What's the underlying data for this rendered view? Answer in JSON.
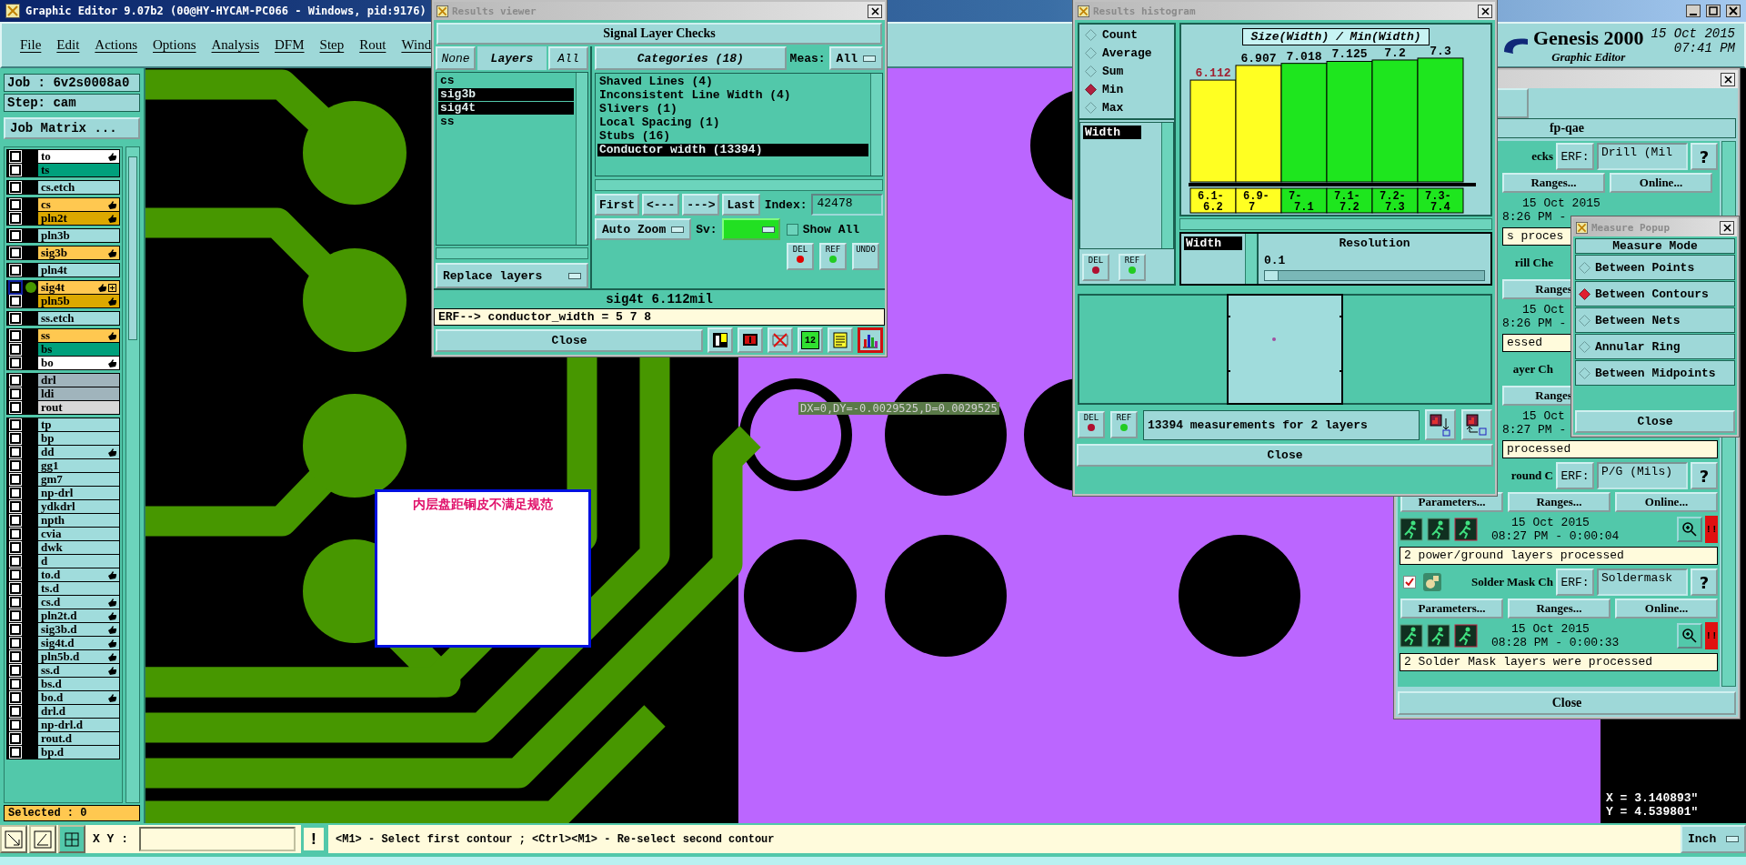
{
  "window": {
    "title": "Graphic Editor 9.07b2 (00@HY-HYCAM-PC066 - Windows, pid:9176)"
  },
  "menu": [
    "File",
    "Edit",
    "Actions",
    "Options",
    "Analysis",
    "DFM",
    "Step",
    "Rout",
    "Wind"
  ],
  "brand": {
    "name": "Genesis 2000",
    "subtitle": "Graphic Editor",
    "date": "15 Oct 2015",
    "time": "07:41 PM"
  },
  "job": {
    "job": "Job : 6v2s0008a0",
    "step": "Step: cam",
    "matrix_button": "Job Matrix ..."
  },
  "layer_groups": [
    {
      "layers": [
        {
          "name": "to",
          "color": "#ffffff",
          "affected": true,
          "work": false,
          "checked": false
        },
        {
          "name": "ts",
          "color": "#00a07c",
          "affected": false,
          "work": false,
          "checked": false
        }
      ]
    },
    {
      "layers": [
        {
          "name": "cs.etch",
          "color": "#a0dcdc",
          "affected": false,
          "work": false,
          "checked": false
        }
      ]
    },
    {
      "layers": [
        {
          "name": "cs",
          "color": "#ffc850",
          "affected": true,
          "work": false,
          "checked": false
        },
        {
          "name": "pln2t",
          "color": "#dca800",
          "affected": true,
          "work": false,
          "checked": false
        }
      ]
    },
    {
      "layers": [
        {
          "name": "pln3b",
          "color": "#a0dcdc",
          "affected": false,
          "work": false,
          "checked": false
        }
      ]
    },
    {
      "layers": [
        {
          "name": "sig3b",
          "color": "#ffc850",
          "affected": true,
          "work": false,
          "checked": false
        }
      ]
    },
    {
      "layers": [
        {
          "name": "pln4t",
          "color": "#a0dcdc",
          "affected": false,
          "work": false,
          "checked": false
        }
      ]
    },
    {
      "layers": [
        {
          "name": "sig4t",
          "color": "#ffc850",
          "affected": true,
          "work": true,
          "checked": false
        },
        {
          "name": "pln5b",
          "color": "#dca800",
          "affected": true,
          "work": false,
          "checked": false
        }
      ]
    },
    {
      "layers": [
        {
          "name": "ss.etch",
          "color": "#a0dcdc",
          "affected": false,
          "work": false,
          "checked": false
        }
      ]
    },
    {
      "layers": [
        {
          "name": "ss",
          "color": "#ffc850",
          "affected": true,
          "work": false,
          "checked": false
        },
        {
          "name": "bs",
          "color": "#00a07c",
          "affected": false,
          "work": false,
          "checked": false
        },
        {
          "name": "bo",
          "color": "#ffffff",
          "affected": true,
          "work": false,
          "checked": false
        }
      ]
    },
    {
      "layers": [
        {
          "name": "drl",
          "color": "#a0b4bc",
          "affected": false,
          "work": false,
          "checked": false
        },
        {
          "name": "ldi",
          "color": "#a0b4bc",
          "affected": false,
          "work": false,
          "checked": false
        },
        {
          "name": "rout",
          "color": "#d8d8d8",
          "affected": false,
          "work": false,
          "checked": false
        }
      ]
    },
    {
      "layers": [
        {
          "name": "tp",
          "color": "#a0dcdc",
          "affected": false,
          "work": false,
          "checked": false
        },
        {
          "name": "bp",
          "color": "#a0dcdc",
          "affected": false,
          "work": false,
          "checked": false
        },
        {
          "name": "dd",
          "color": "#a0dcdc",
          "affected": true,
          "work": false,
          "checked": false
        },
        {
          "name": "gg1",
          "color": "#a0dcdc",
          "affected": false,
          "work": false,
          "checked": false
        },
        {
          "name": "gm7",
          "color": "#a0dcdc",
          "affected": false,
          "work": false,
          "checked": false
        },
        {
          "name": "np-drl",
          "color": "#a0dcdc",
          "affected": false,
          "work": false,
          "checked": false
        },
        {
          "name": "ydkdrl",
          "color": "#a0dcdc",
          "affected": false,
          "work": false,
          "checked": false
        },
        {
          "name": "npth",
          "color": "#a0dcdc",
          "affected": false,
          "work": false,
          "checked": false
        },
        {
          "name": "cvia",
          "color": "#a0dcdc",
          "affected": false,
          "work": false,
          "checked": false
        },
        {
          "name": "dwk",
          "color": "#a0dcdc",
          "affected": false,
          "work": false,
          "checked": false
        },
        {
          "name": "d",
          "color": "#a0dcdc",
          "affected": false,
          "work": false,
          "checked": false
        },
        {
          "name": "to.d",
          "color": "#a0dcdc",
          "affected": true,
          "work": false,
          "checked": false
        },
        {
          "name": "ts.d",
          "color": "#a0dcdc",
          "affected": false,
          "work": false,
          "checked": false
        },
        {
          "name": "cs.d",
          "color": "#a0dcdc",
          "affected": true,
          "work": false,
          "checked": false
        },
        {
          "name": "pln2t.d",
          "color": "#a0dcdc",
          "affected": true,
          "work": false,
          "checked": false
        },
        {
          "name": "sig3b.d",
          "color": "#a0dcdc",
          "affected": true,
          "work": false,
          "checked": false
        },
        {
          "name": "sig4t.d",
          "color": "#a0dcdc",
          "affected": true,
          "work": false,
          "checked": false
        },
        {
          "name": "pln5b.d",
          "color": "#a0dcdc",
          "affected": true,
          "work": false,
          "checked": false
        },
        {
          "name": "ss.d",
          "color": "#a0dcdc",
          "affected": true,
          "work": false,
          "checked": false
        },
        {
          "name": "bs.d",
          "color": "#a0dcdc",
          "affected": false,
          "work": false,
          "checked": false
        },
        {
          "name": "bo.d",
          "color": "#a0dcdc",
          "affected": true,
          "work": false,
          "checked": false
        },
        {
          "name": "drl.d",
          "color": "#a0dcdc",
          "affected": false,
          "work": false,
          "checked": false
        },
        {
          "name": "np-drl.d",
          "color": "#a0dcdc",
          "affected": false,
          "work": false,
          "checked": false
        },
        {
          "name": "rout.d",
          "color": "#a0dcdc",
          "affected": false,
          "work": false,
          "checked": false
        },
        {
          "name": "bp.d",
          "color": "#a0dcdc",
          "affected": false,
          "work": false,
          "checked": false
        }
      ]
    }
  ],
  "selected_count": "Selected : 0",
  "canvas": {
    "note": "内层盘距铜皮不满足规范",
    "measurement": "DX=0,DY=-0.0029525,D=0.0029525",
    "readout": [
      "X = 3.140893\"",
      "Y = 4.539801\""
    ]
  },
  "bottom_bar": {
    "xy_label": "X Y :",
    "alert": "!",
    "prompt": "<M1> - Select first contour ; <Ctrl><M1> - Re-select second contour",
    "units": "Inch"
  },
  "results_viewer": {
    "title": "Results viewer",
    "header": "Signal Layer Checks",
    "layer_buttons": [
      {
        "label": "None",
        "kind": "none"
      },
      {
        "label": "Layers",
        "kind": "title"
      },
      {
        "label": "All",
        "kind": "all"
      }
    ],
    "layers": [
      {
        "name": "cs",
        "selected": false
      },
      {
        "name": "sig3b",
        "selected": true
      },
      {
        "name": "sig4t",
        "selected": true
      },
      {
        "name": "ss",
        "selected": false
      }
    ],
    "replace": "Replace layers",
    "categories_label": "Categories (18)",
    "meas_label": "Meas:",
    "meas_value": "All",
    "categories": [
      {
        "name": "Shaved Lines (4)",
        "selected": false
      },
      {
        "name": "Inconsistent Line Width (4)",
        "selected": false
      },
      {
        "name": "Slivers (1)",
        "selected": false
      },
      {
        "name": "Local Spacing (1)",
        "selected": false
      },
      {
        "name": "Stubs (16)",
        "selected": false
      },
      {
        "name": "Conductor width (13394)",
        "selected": true
      }
    ],
    "nav": [
      "First",
      "<---",
      "--->",
      "Last"
    ],
    "index_label": "Index:",
    "index_value": "42478",
    "auto_zoom": "Auto Zoom",
    "sv_label": "Sv:",
    "show_all": {
      "label": "Show All",
      "checked": false
    },
    "actions": [
      "DEL",
      "REF",
      "UNDO"
    ],
    "status": "sig4t 6.112mil",
    "erf": "ERF--> conductor_width = 5 7 8",
    "close": "Close",
    "tools": [
      {
        "kind": "figure",
        "selected": false
      },
      {
        "kind": "monitor",
        "selected": false
      },
      {
        "kind": "crossed",
        "selected": false
      },
      {
        "kind": "numbered",
        "label": "12",
        "selected": false
      },
      {
        "kind": "notes",
        "selected": false
      },
      {
        "kind": "chart",
        "selected": true
      }
    ]
  },
  "histogram": {
    "title": "Results histogram",
    "modes": [
      {
        "label": "Count",
        "selected": false
      },
      {
        "label": "Average",
        "selected": false
      },
      {
        "label": "Sum",
        "selected": false
      },
      {
        "label": "Min",
        "selected": true
      },
      {
        "label": "Max",
        "selected": false
      }
    ],
    "fields": [
      {
        "name": "Width",
        "selected": true
      }
    ],
    "list_actions": [
      "DEL",
      "REF"
    ],
    "chart_data": {
      "type": "bar",
      "title": "Size(Width) / Min(Width)",
      "categories": [
        "6.1-6.2",
        "6.9-7",
        "7-7.1",
        "7.1-7.2",
        "7.2-7.3",
        "7.3-7.4"
      ],
      "data_labels": true,
      "series": [
        {
          "color": "#ffff22",
          "values": [
            6.112,
            6.907,
            null,
            null,
            null,
            null
          ]
        },
        {
          "color": "#1ee61e",
          "values": [
            null,
            null,
            7.018,
            7.125,
            7.2,
            7.3
          ]
        }
      ]
    },
    "resolution_fields": [
      {
        "name": "Width",
        "selected": true
      }
    ],
    "resolution": {
      "label": "Resolution",
      "value": "0.1",
      "level": 0.06
    },
    "actions": [
      "DEL",
      "REF"
    ],
    "summary": "13394 measurements for 2 layers",
    "close": "Close"
  },
  "checklist": {
    "header": "fp-qae",
    "close": "Close",
    "checks": [
      {
        "kind": "covered",
        "label": "ecks",
        "erf": "ERF:",
        "erf_value": "Drill (Mil",
        "help": "?",
        "buttons": [
          "Ranges...",
          "Online..."
        ],
        "date": "15 Oct 2015",
        "time": "8:26 PM -",
        "status": "s proces"
      },
      {
        "kind": "covered",
        "label": "rill Che",
        "buttons": [
          "Ranges"
        ],
        "date": "15 Oct",
        "time": "8:26 PM -",
        "status": "essed"
      },
      {
        "kind": "covered",
        "label": "ayer Ch",
        "buttons": [
          "Ranges"
        ],
        "date": "15 Oct",
        "time": "8:27 PM -",
        "status": "processed"
      },
      {
        "kind": "full",
        "label": "round C",
        "erf": "ERF:",
        "erf_value": "P/G (Mils)",
        "help": "?",
        "buttons": [
          "Parameters...",
          "Ranges...",
          "Online..."
        ],
        "date": "15 Oct 2015",
        "time": "08:27 PM - 0:00:04",
        "flag": "!!",
        "status": "2 power/ground layers processed"
      },
      {
        "kind": "full",
        "checked": true,
        "label": "Solder Mask Ch",
        "erf": "ERF:",
        "erf_value": "Soldermask",
        "help": "?",
        "buttons": [
          "Parameters...",
          "Ranges...",
          "Online..."
        ],
        "date": "15 Oct 2015",
        "time": "08:28 PM - 0:00:33",
        "flag": "!!",
        "status": "2 Solder Mask layers were processed"
      }
    ]
  },
  "measure_popup": {
    "title": "Measure Popup",
    "header": "Measure Mode",
    "close": "Close",
    "modes": [
      {
        "label": "Between Points",
        "selected": false
      },
      {
        "label": "Between Contours",
        "selected": true
      },
      {
        "label": "Between Nets",
        "selected": false
      },
      {
        "label": "Annular Ring",
        "selected": false
      },
      {
        "label": "Between Midpoints",
        "selected": false
      }
    ]
  }
}
